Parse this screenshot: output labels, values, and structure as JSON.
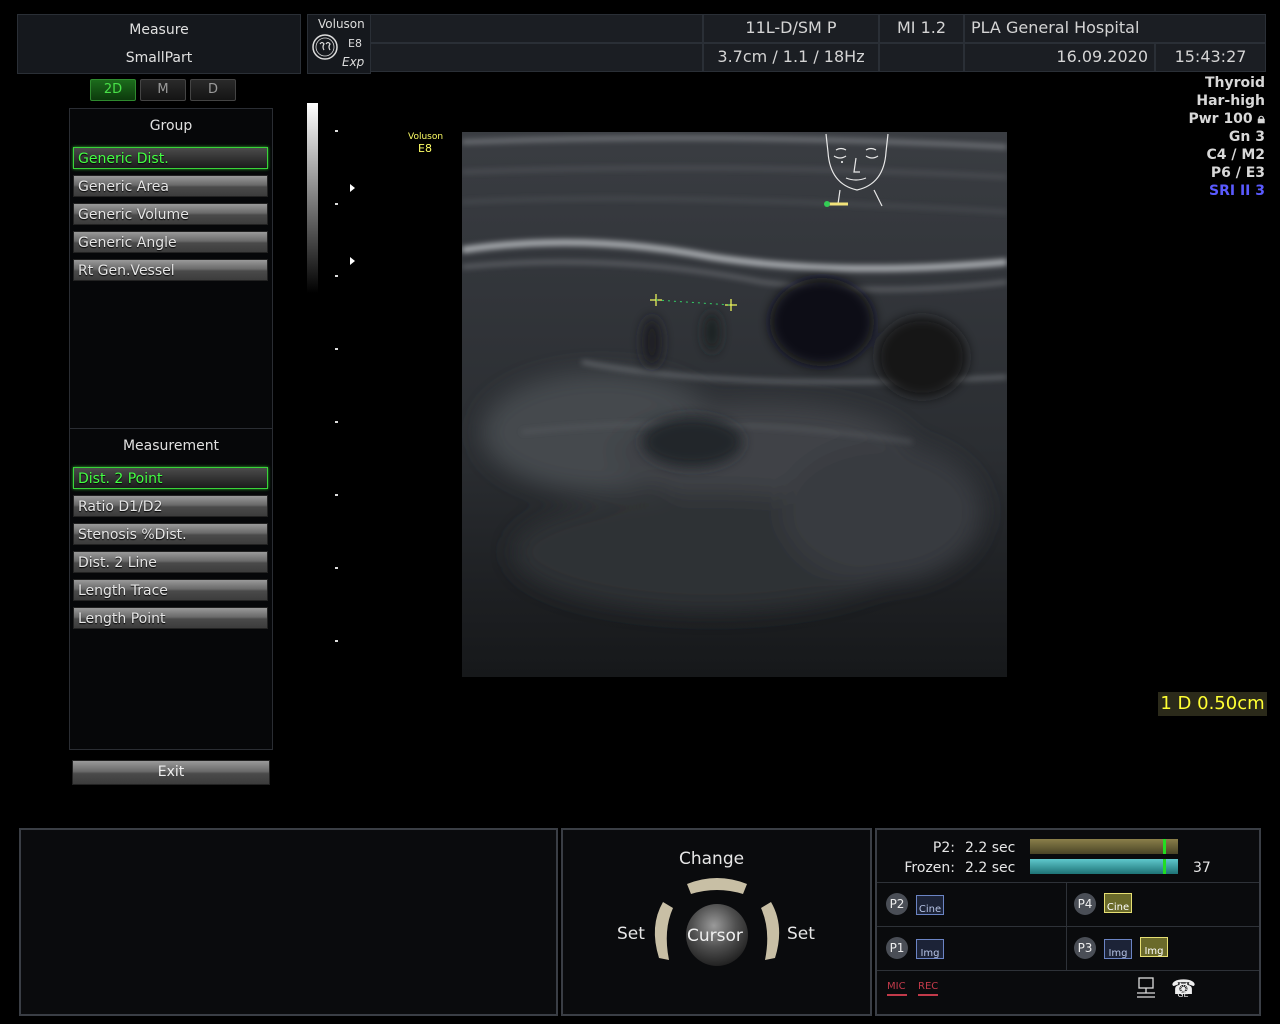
{
  "mode": {
    "line1": "Measure",
    "line2": "SmallPart"
  },
  "tabs": [
    {
      "label": "2D",
      "active": true
    },
    {
      "label": "M",
      "active": false
    },
    {
      "label": "D",
      "active": false
    }
  ],
  "group": {
    "title": "Group",
    "items": [
      "Generic Dist.",
      "Generic Area",
      "Generic Volume",
      "Generic Angle",
      "Rt Gen.Vessel"
    ],
    "selected": 0
  },
  "measurement": {
    "title": "Measurement",
    "items": [
      "Dist. 2 Point",
      "Ratio D1/D2",
      "Stenosis %Dist.",
      "Dist. 2 Line",
      "Length Trace",
      "Length Point"
    ],
    "selected": 0
  },
  "exit_label": "Exit",
  "header": {
    "brand": "Voluson",
    "model": "E8",
    "mode_tag": "Exp",
    "logo": "ge-logo",
    "probe": "11L-D/SM P",
    "mi": "MI  1.2",
    "hospital": "PLA General Hospital",
    "depth_info": "3.7cm / 1.1 / 18Hz",
    "date": "16.09.2020",
    "time": "15:43:27"
  },
  "params": [
    "Thyroid",
    "Har-high",
    "Pwr 100",
    "Gn   3",
    "C4 / M2",
    "P6 / E3",
    "SRI II 3"
  ],
  "image_brand": {
    "line1": "Voluson",
    "line2": "E8"
  },
  "measurement_result": "1  D 0.50cm",
  "controls": {
    "top": "Change",
    "left": "Set",
    "right": "Set",
    "center": "Cursor"
  },
  "cine": {
    "p2_label": "P2:",
    "p2_value": "2.2 sec",
    "frozen_label": "Frozen:",
    "frozen_value": "2.2 sec",
    "frame_count": "37",
    "p2_bar_color": "#6b6236",
    "frozen_bar_color": "#2aa0a4",
    "marker_color": "#22dd22"
  },
  "presets": [
    {
      "badge": "P2",
      "boxes": [
        {
          "label": "Cine",
          "style": "blue"
        }
      ]
    },
    {
      "badge": "P4",
      "boxes": [
        {
          "label": "Cine",
          "style": "yellow"
        }
      ]
    },
    {
      "badge": "P1",
      "boxes": [
        {
          "label": "Img",
          "style": "blue"
        }
      ]
    },
    {
      "badge": "P3",
      "boxes": [
        {
          "label": "Img",
          "style": "blue"
        },
        {
          "label": "Img",
          "style": "yellow"
        }
      ]
    }
  ],
  "status": {
    "mic": "MIC",
    "rec": "REC",
    "ge": "GE"
  },
  "colors": {
    "accent_green": "#44ff44",
    "result_yellow": "#ffff33",
    "sri_blue": "#5a5aff"
  }
}
